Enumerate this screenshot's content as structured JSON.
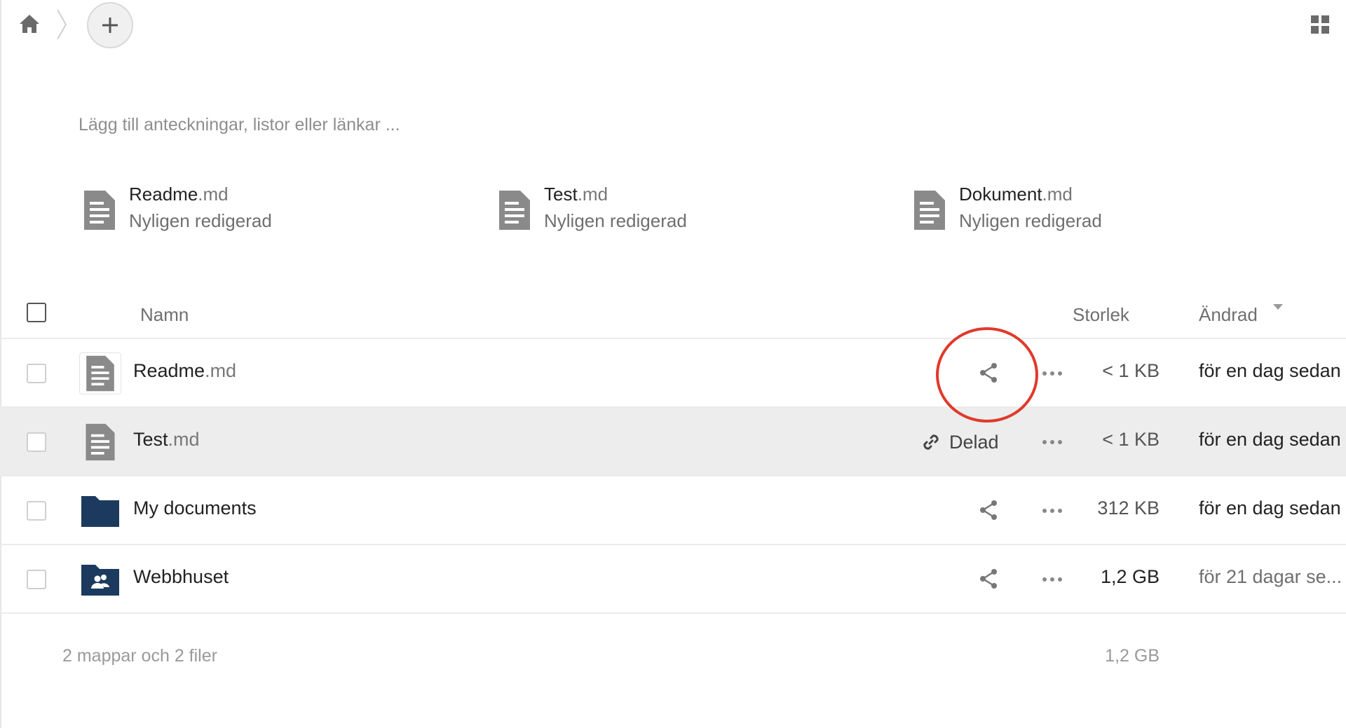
{
  "toolbar": {
    "home_icon": "home-icon",
    "new_button_icon": "plus-icon",
    "view_toggle_icon": "grid-view-icon"
  },
  "notes": {
    "placeholder": "Lägg till anteckningar, listor eller länkar ..."
  },
  "recent": [
    {
      "base": "Readme",
      "ext": ".md",
      "subtitle": "Nyligen redigerad"
    },
    {
      "base": "Test",
      "ext": ".md",
      "subtitle": "Nyligen redigerad"
    },
    {
      "base": "Dokument",
      "ext": ".md",
      "subtitle": "Nyligen redigerad"
    }
  ],
  "table": {
    "columns": {
      "name": "Namn",
      "size": "Storlek",
      "modified": "Ändrad"
    },
    "rows": [
      {
        "base": "Readme",
        "ext": ".md",
        "type": "document",
        "share_label": "",
        "size": "< 1 KB",
        "modified": "för en dag sedan"
      },
      {
        "base": "Test",
        "ext": ".md",
        "type": "document",
        "share_label": "Delad",
        "size": "< 1 KB",
        "modified": "för en dag sedan"
      },
      {
        "base": "My documents",
        "ext": "",
        "type": "folder",
        "share_label": "",
        "size": "312 KB",
        "modified": "för en dag sedan"
      },
      {
        "base": "Webbhuset",
        "ext": "",
        "type": "group-folder",
        "share_label": "",
        "size": "1,2 GB",
        "modified": "för 21 dagar se..."
      }
    ],
    "summary": {
      "text": "2 mappar och 2 filer",
      "size": "1,2 GB"
    }
  },
  "colors": {
    "folder": "#1c3a5e",
    "doc_icon": "#8a8a8a",
    "highlight": "#e0392b",
    "hover_row": "#ededed"
  }
}
